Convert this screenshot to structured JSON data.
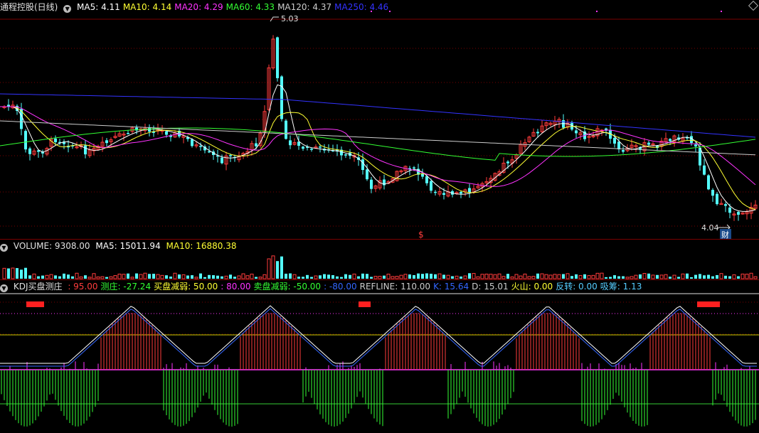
{
  "colors": {
    "up": "#ff3c3c",
    "down": "#54ffff",
    "ma5": "#ffffff",
    "ma10": "#ffff33",
    "ma20": "#ff33ff",
    "ma60": "#33ff33",
    "ma120": "#cccccc",
    "ma250": "#3333ff",
    "grid": "#7a0000",
    "kdj_k": "#ffffff",
    "kdj_d": "#3366ff",
    "bar_up": "#ff3c3c",
    "bar_down": "#33ff33",
    "magenta": "#ff33ff"
  },
  "main": {
    "title": "通程控股(日线)",
    "ma": [
      {
        "label": "MA5: 4.11",
        "color": "#ffffff"
      },
      {
        "label": "MA10: 4.14",
        "color": "#ffff33"
      },
      {
        "label": "MA20: 4.29",
        "color": "#ff33ff"
      },
      {
        "label": "MA60: 4.33",
        "color": "#33ff33"
      },
      {
        "label": "MA120: 4.37",
        "color": "#cccccc"
      },
      {
        "label": "MA250: 4.46",
        "color": "#3333ff"
      }
    ],
    "high_label": "5.03",
    "low_label": "4.04",
    "finance_badge": "财",
    "marker": "$"
  },
  "volume": {
    "title": "VOLUME: 9308.00",
    "ma5": "MA5: 15011.94",
    "ma10": "MA10: 16880.38"
  },
  "kdj": {
    "name": "KDJ买盘测庄",
    "items": [
      {
        "label": ": 95.00",
        "color": "#ff3c3c"
      },
      {
        "label": "测庄: -27.24",
        "color": "#33ff33"
      },
      {
        "label": "买盘减弱: 50.00",
        "color": "#ffff33"
      },
      {
        "label": ": 80.00",
        "color": "#ff33ff"
      },
      {
        "label": "卖盘减弱: -50.00",
        "color": "#33ff33"
      },
      {
        "label": ": -80.00",
        "color": "#3366ff"
      },
      {
        "label": "REFLINE: 110.00",
        "color": "#cccccc"
      },
      {
        "label": "K: 15.64",
        "color": "#3366ff"
      },
      {
        "label": "D: 15.01",
        "color": "#cccccc"
      },
      {
        "label": "火山: 0.00",
        "color": "#ffff33"
      },
      {
        "label": "反转: 0.00",
        "color": "#55ccff"
      },
      {
        "label": "吸筹: 1.13",
        "color": "#55ccff"
      }
    ]
  }
}
